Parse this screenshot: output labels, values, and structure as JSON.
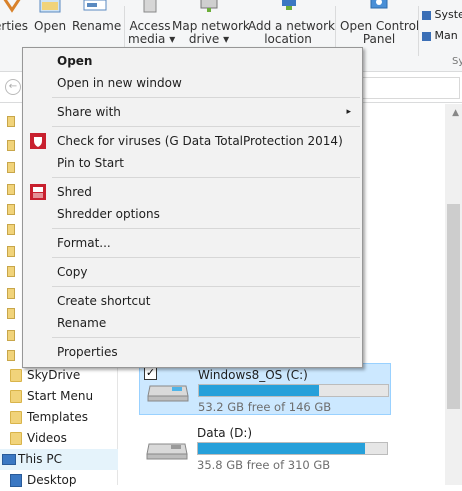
{
  "ribbon": {
    "buttons": [
      {
        "label": "erties"
      },
      {
        "label": "Open"
      },
      {
        "label": "Rename"
      },
      {
        "label": "Access",
        "label2": "media ▾"
      },
      {
        "label": "Map network",
        "label2": "drive ▾"
      },
      {
        "label": "Add a network",
        "label2": "location"
      },
      {
        "label": "Open Control",
        "label2": "Panel"
      }
    ],
    "side_items": [
      "Syste",
      "Man"
    ],
    "group_label": "Sy"
  },
  "nav": {
    "items": [
      {
        "label": "SkyDrive"
      },
      {
        "label": "Start Menu"
      },
      {
        "label": "Templates"
      },
      {
        "label": "Videos"
      },
      {
        "label": "This PC"
      },
      {
        "label": "Desktop"
      }
    ]
  },
  "drives": [
    {
      "name": "Windows8_OS (C:)",
      "free": "53.2 GB free of 146 GB",
      "used_fraction": 0.636,
      "selected": true
    },
    {
      "name": "Data (D:)",
      "free": "35.8 GB free of 310 GB",
      "used_fraction": 0.885,
      "selected": false
    }
  ],
  "context_menu": {
    "items": [
      {
        "label": "Open"
      },
      {
        "label": "Open in new window"
      },
      {
        "label": "Share with"
      },
      {
        "label": "Check for viruses (G Data TotalProtection 2014)"
      },
      {
        "label": "Pin to Start"
      },
      {
        "label": "Shred"
      },
      {
        "label": "Shredder options"
      },
      {
        "label": "Format..."
      },
      {
        "label": "Copy"
      },
      {
        "label": "Create shortcut"
      },
      {
        "label": "Rename"
      },
      {
        "label": "Properties"
      }
    ],
    "submenu_arrow": "▸"
  },
  "colors": {
    "accent": "#26a0da",
    "selection": "#cce8ff",
    "gdata_red": "#c8202e"
  }
}
